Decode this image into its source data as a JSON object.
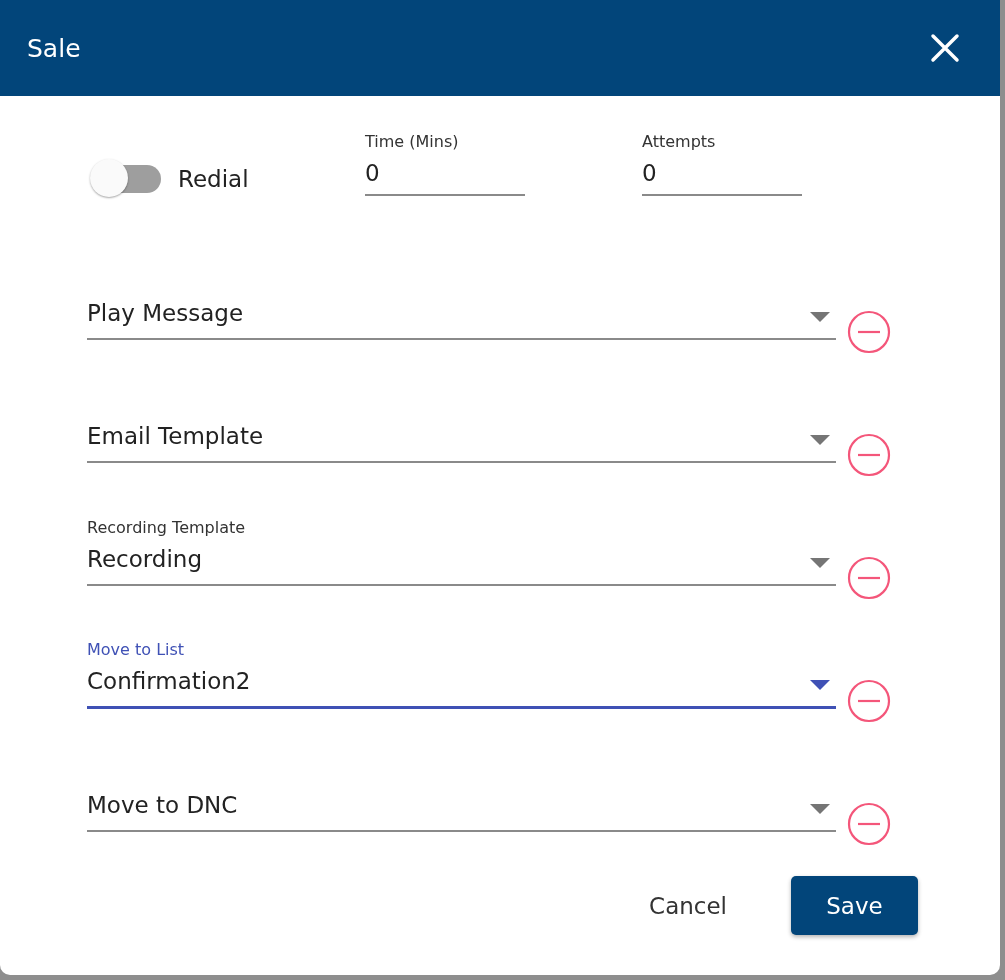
{
  "dialog": {
    "title": "Sale"
  },
  "redial": {
    "label": "Redial",
    "on": false
  },
  "number_fields": [
    {
      "label": "Time (Mins)",
      "value": "0"
    },
    {
      "label": "Attempts",
      "value": "0"
    }
  ],
  "selects": [
    {
      "placeholder": "Play Message",
      "focused": false
    },
    {
      "placeholder": "Email Template",
      "focused": false
    },
    {
      "label": "Recording Template",
      "value": "Recording",
      "focused": false
    },
    {
      "label": "Move to List",
      "value": "Confirmation2",
      "focused": true
    },
    {
      "placeholder": "Move to DNC",
      "focused": false
    }
  ],
  "buttons": {
    "cancel": "Cancel",
    "save": "Save"
  }
}
